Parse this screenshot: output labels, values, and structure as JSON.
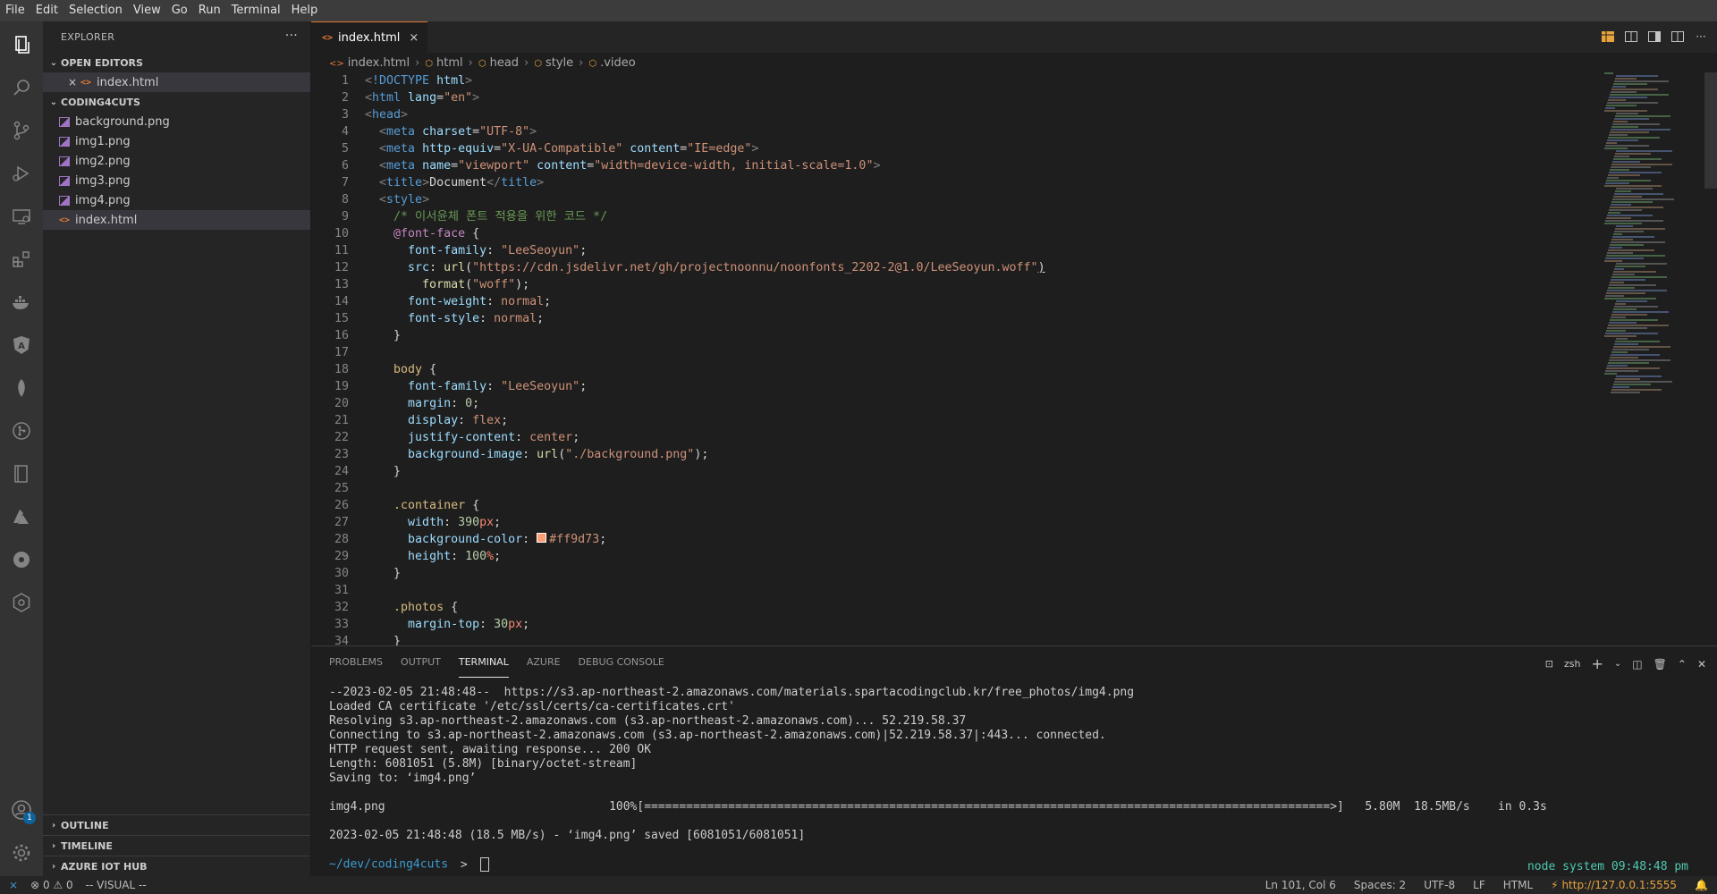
{
  "menu": [
    "File",
    "Edit",
    "Selection",
    "View",
    "Go",
    "Run",
    "Terminal",
    "Help"
  ],
  "activity_icons": [
    {
      "name": "explorer-icon",
      "glyph": "files"
    },
    {
      "name": "search-icon",
      "glyph": "search"
    },
    {
      "name": "source-control-icon",
      "glyph": "git"
    },
    {
      "name": "run-debug-icon",
      "glyph": "play"
    },
    {
      "name": "remote-explorer-icon",
      "glyph": "monitor"
    },
    {
      "name": "extensions-icon",
      "glyph": "blocks"
    },
    {
      "name": "docker-icon",
      "glyph": "docker"
    },
    {
      "name": "angular-icon",
      "glyph": "A"
    },
    {
      "name": "mongodb-icon",
      "glyph": "leaf"
    },
    {
      "name": "gitlens-icon",
      "glyph": "git-circle"
    },
    {
      "name": "notebook-icon",
      "glyph": "book"
    },
    {
      "name": "azure-icon",
      "glyph": "azure"
    },
    {
      "name": "kubernetes-icon",
      "glyph": "helm"
    },
    {
      "name": "settings-hex-icon",
      "glyph": "gear-hex"
    }
  ],
  "accounts_badge": "1",
  "sidebar": {
    "title": "EXPLORER",
    "more": "···",
    "open_editors_label": "OPEN EDITORS",
    "open_editors": [
      {
        "close": "×",
        "name": "index.html"
      }
    ],
    "folder_label": "CODING4CUTS",
    "files": [
      {
        "name": "background.png",
        "type": "img"
      },
      {
        "name": "img1.png",
        "type": "img"
      },
      {
        "name": "img2.png",
        "type": "img"
      },
      {
        "name": "img3.png",
        "type": "img"
      },
      {
        "name": "img4.png",
        "type": "img"
      },
      {
        "name": "index.html",
        "type": "html"
      }
    ],
    "bottom_sections": [
      "OUTLINE",
      "TIMELINE",
      "AZURE IOT HUB"
    ]
  },
  "tab": {
    "label": "index.html",
    "close": "×",
    "icon": "<>"
  },
  "breadcrumb": [
    "index.html",
    "html",
    "head",
    "style",
    ".video"
  ],
  "code_lines": [
    [
      [
        "#808080",
        "<"
      ],
      [
        "#569cd6",
        "!DOCTYPE"
      ],
      [
        "#9cdcfe",
        " html"
      ],
      [
        "#808080",
        ">"
      ]
    ],
    [
      [
        "#808080",
        "<"
      ],
      [
        "#569cd6",
        "html"
      ],
      [
        "#9cdcfe",
        " lang"
      ],
      [
        "#d4d4d4",
        "="
      ],
      [
        "#ce9178",
        "\"en\""
      ],
      [
        "#808080",
        ">"
      ]
    ],
    [
      [
        "#808080",
        "<"
      ],
      [
        "#569cd6",
        "head"
      ],
      [
        "#808080",
        ">"
      ]
    ],
    [
      [
        "#d4d4d4",
        "  "
      ],
      [
        "#808080",
        "<"
      ],
      [
        "#569cd6",
        "meta"
      ],
      [
        "#9cdcfe",
        " charset"
      ],
      [
        "#d4d4d4",
        "="
      ],
      [
        "#ce9178",
        "\"UTF-8\""
      ],
      [
        "#808080",
        ">"
      ]
    ],
    [
      [
        "#d4d4d4",
        "  "
      ],
      [
        "#808080",
        "<"
      ],
      [
        "#569cd6",
        "meta"
      ],
      [
        "#9cdcfe",
        " http-equiv"
      ],
      [
        "#d4d4d4",
        "="
      ],
      [
        "#ce9178",
        "\"X-UA-Compatible\""
      ],
      [
        "#9cdcfe",
        " content"
      ],
      [
        "#d4d4d4",
        "="
      ],
      [
        "#ce9178",
        "\"IE=edge\""
      ],
      [
        "#808080",
        ">"
      ]
    ],
    [
      [
        "#d4d4d4",
        "  "
      ],
      [
        "#808080",
        "<"
      ],
      [
        "#569cd6",
        "meta"
      ],
      [
        "#9cdcfe",
        " name"
      ],
      [
        "#d4d4d4",
        "="
      ],
      [
        "#ce9178",
        "\"viewport\""
      ],
      [
        "#9cdcfe",
        " content"
      ],
      [
        "#d4d4d4",
        "="
      ],
      [
        "#ce9178",
        "\"width=device-width, initial-scale=1.0\""
      ],
      [
        "#808080",
        ">"
      ]
    ],
    [
      [
        "#d4d4d4",
        "  "
      ],
      [
        "#808080",
        "<"
      ],
      [
        "#569cd6",
        "title"
      ],
      [
        "#808080",
        ">"
      ],
      [
        "#d4d4d4",
        "Document"
      ],
      [
        "#808080",
        "</"
      ],
      [
        "#569cd6",
        "title"
      ],
      [
        "#808080",
        ">"
      ]
    ],
    [
      [
        "#d4d4d4",
        "  "
      ],
      [
        "#808080",
        "<"
      ],
      [
        "#569cd6",
        "style"
      ],
      [
        "#808080",
        ">"
      ]
    ],
    [
      [
        "#6a9955",
        "    /* 이서윤체 폰트 적용을 위한 코드 */"
      ]
    ],
    [
      [
        "#d4d4d4",
        "    "
      ],
      [
        "#c586c0",
        "@font-face"
      ],
      [
        "#d4d4d4",
        " {"
      ]
    ],
    [
      [
        "#d4d4d4",
        "      "
      ],
      [
        "#9cdcfe",
        "font-family"
      ],
      [
        "#d4d4d4",
        ": "
      ],
      [
        "#ce9178",
        "\"LeeSeoyun\""
      ],
      [
        "#d4d4d4",
        ";"
      ]
    ],
    [
      [
        "#d4d4d4",
        "      "
      ],
      [
        "#9cdcfe",
        "src"
      ],
      [
        "#d4d4d4",
        ": "
      ],
      [
        "#dcdcaa",
        "url"
      ],
      [
        "#d4d4d4",
        "("
      ],
      [
        "#ce9178",
        "\"https://cdn.jsdelivr.net/gh/projectnoonnu/noonfonts_2202-2@1.0/LeeSeoyun.woff\""
      ],
      [
        "#d4d4d4",
        ")"
      ]
    ],
    [
      [
        "#d4d4d4",
        "        "
      ],
      [
        "#dcdcaa",
        "format"
      ],
      [
        "#d4d4d4",
        "("
      ],
      [
        "#ce9178",
        "\"woff\""
      ],
      [
        "#d4d4d4",
        ");"
      ]
    ],
    [
      [
        "#d4d4d4",
        "      "
      ],
      [
        "#9cdcfe",
        "font-weight"
      ],
      [
        "#d4d4d4",
        ": "
      ],
      [
        "#ce9178",
        "normal"
      ],
      [
        "#d4d4d4",
        ";"
      ]
    ],
    [
      [
        "#d4d4d4",
        "      "
      ],
      [
        "#9cdcfe",
        "font-style"
      ],
      [
        "#d4d4d4",
        ": "
      ],
      [
        "#ce9178",
        "normal"
      ],
      [
        "#d4d4d4",
        ";"
      ]
    ],
    [
      [
        "#d4d4d4",
        "    }"
      ]
    ],
    [
      [
        "#d4d4d4",
        ""
      ]
    ],
    [
      [
        "#d4d4d4",
        "    "
      ],
      [
        "#d7ba7d",
        "body"
      ],
      [
        "#d4d4d4",
        " {"
      ]
    ],
    [
      [
        "#d4d4d4",
        "      "
      ],
      [
        "#9cdcfe",
        "font-family"
      ],
      [
        "#d4d4d4",
        ": "
      ],
      [
        "#ce9178",
        "\"LeeSeoyun\""
      ],
      [
        "#d4d4d4",
        ";"
      ]
    ],
    [
      [
        "#d4d4d4",
        "      "
      ],
      [
        "#9cdcfe",
        "margin"
      ],
      [
        "#d4d4d4",
        ": "
      ],
      [
        "#b5cea8",
        "0"
      ],
      [
        "#d4d4d4",
        ";"
      ]
    ],
    [
      [
        "#d4d4d4",
        "      "
      ],
      [
        "#9cdcfe",
        "display"
      ],
      [
        "#d4d4d4",
        ": "
      ],
      [
        "#ce9178",
        "flex"
      ],
      [
        "#d4d4d4",
        ";"
      ]
    ],
    [
      [
        "#d4d4d4",
        "      "
      ],
      [
        "#9cdcfe",
        "justify-content"
      ],
      [
        "#d4d4d4",
        ": "
      ],
      [
        "#ce9178",
        "center"
      ],
      [
        "#d4d4d4",
        ";"
      ]
    ],
    [
      [
        "#d4d4d4",
        "      "
      ],
      [
        "#9cdcfe",
        "background-image"
      ],
      [
        "#d4d4d4",
        ": "
      ],
      [
        "#dcdcaa",
        "url"
      ],
      [
        "#d4d4d4",
        "("
      ],
      [
        "#ce9178",
        "\"./background.png\""
      ],
      [
        "#d4d4d4",
        ");"
      ]
    ],
    [
      [
        "#d4d4d4",
        "    }"
      ]
    ],
    [
      [
        "#d4d4d4",
        ""
      ]
    ],
    [
      [
        "#d4d4d4",
        "    "
      ],
      [
        "#d7ba7d",
        ".container"
      ],
      [
        "#d4d4d4",
        " {"
      ]
    ],
    [
      [
        "#d4d4d4",
        "      "
      ],
      [
        "#9cdcfe",
        "width"
      ],
      [
        "#d4d4d4",
        ": "
      ],
      [
        "#b5cea8",
        "390"
      ],
      [
        "#f48771",
        "px"
      ],
      [
        "#d4d4d4",
        ";"
      ]
    ],
    [
      [
        "#d4d4d4",
        "      "
      ],
      [
        "#9cdcfe",
        "background-color"
      ],
      [
        "#d4d4d4",
        ": "
      ],
      [
        "swatch",
        "#ff9d73"
      ],
      [
        "#ce9178",
        "#ff9d73"
      ],
      [
        "#d4d4d4",
        ";"
      ]
    ],
    [
      [
        "#d4d4d4",
        "      "
      ],
      [
        "#9cdcfe",
        "height"
      ],
      [
        "#d4d4d4",
        ": "
      ],
      [
        "#b5cea8",
        "100"
      ],
      [
        "#f48771",
        "%"
      ],
      [
        "#d4d4d4",
        ";"
      ]
    ],
    [
      [
        "#d4d4d4",
        "    }"
      ]
    ],
    [
      [
        "#d4d4d4",
        ""
      ]
    ],
    [
      [
        "#d4d4d4",
        "    "
      ],
      [
        "#d7ba7d",
        ".photos"
      ],
      [
        "#d4d4d4",
        " {"
      ]
    ],
    [
      [
        "#d4d4d4",
        "      "
      ],
      [
        "#9cdcfe",
        "margin-top"
      ],
      [
        "#d4d4d4",
        ": "
      ],
      [
        "#b5cea8",
        "30"
      ],
      [
        "#f48771",
        "px"
      ],
      [
        "#d4d4d4",
        ";"
      ]
    ],
    [
      [
        "#d4d4d4",
        "    }"
      ]
    ]
  ],
  "panel": {
    "tabs": [
      "PROBLEMS",
      "OUTPUT",
      "TERMINAL",
      "AZURE",
      "DEBUG CONSOLE"
    ],
    "active_tab": "TERMINAL",
    "shell": "zsh",
    "terminal_lines": [
      "--2023-02-05 21:48:48--  https://s3.ap-northeast-2.amazonaws.com/materials.spartacodingclub.kr/free_photos/img4.png",
      "Loaded CA certificate '/etc/ssl/certs/ca-certificates.crt'",
      "Resolving s3.ap-northeast-2.amazonaws.com (s3.ap-northeast-2.amazonaws.com)... 52.219.58.37",
      "Connecting to s3.ap-northeast-2.amazonaws.com (s3.ap-northeast-2.amazonaws.com)|52.219.58.37|:443... connected.",
      "HTTP request sent, awaiting response... 200 OK",
      "Length: 6081051 (5.8M) [binary/octet-stream]",
      "Saving to: ‘img4.png’",
      "",
      "img4.png                                100%[==================================================================================================>]   5.80M  18.5MB/s    in 0.3s",
      "",
      "2023-02-05 21:48:48 (18.5 MB/s) - ‘img4.png’ saved [6081051/6081051]",
      ""
    ],
    "prompt_path": "~/dev/coding4cuts",
    "prompt_symbol": ">",
    "right_prompt_node": "node system",
    "right_prompt_time": "09:48:48 pm"
  },
  "status": {
    "errors": "0",
    "warnings": "0",
    "mode": "-- VISUAL --",
    "position": "Ln 101, Col 6",
    "spaces": "Spaces: 2",
    "encoding": "UTF-8",
    "eol": "LF",
    "language": "HTML",
    "live_server": "http://127.0.0.1:5555"
  },
  "colors": {
    "accent": "#e37933",
    "status_bg": "#252526",
    "sidebar_bg": "#252526",
    "editor_bg": "#1e1e1e"
  }
}
